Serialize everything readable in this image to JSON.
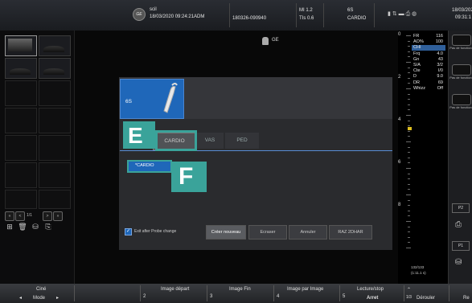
{
  "header": {
    "logo": "GE",
    "patient_name": "scil",
    "datetime": "18/03/2020 09:24:21ADM",
    "exam_id": "180326-090940",
    "mi": "MI 1.2",
    "tis": "TIs 0.6",
    "probe": "6S",
    "app": "CARDIO",
    "clock_date": "18/03/2020",
    "clock_time": "09:31:1"
  },
  "left_panel": {
    "page_indicator": "1/1",
    "nav": [
      "«",
      "<",
      ">",
      "»"
    ]
  },
  "center": {
    "probe_marker": "GE",
    "probe_name": "6S",
    "tabs": [
      "CARDIO",
      "VAS",
      "PED"
    ],
    "preset": "*CARDIO",
    "callout_e": "E",
    "callout_f": "F",
    "exit_checkbox_label": "Exit after Probe change",
    "buttons": [
      "Créer nouveau",
      "Ecraser",
      "Annuler",
      "RAZ 2DHAR"
    ],
    "scale": [
      "0",
      "2",
      "4",
      "6",
      "8"
    ],
    "frame_counter": "132/133",
    "frame_sub": "(1:11.1 s)"
  },
  "params": [
    {
      "k": "FR",
      "v": "116"
    },
    {
      "k": "AO%",
      "v": "100"
    },
    {
      "k": "CHI",
      "v": ""
    },
    {
      "k": "Frq",
      "v": "4.0"
    },
    {
      "k": "Gn",
      "v": "43"
    },
    {
      "k": "S/A",
      "v": "3/2"
    },
    {
      "k": "Cte",
      "v": "I/0"
    },
    {
      "k": "D",
      "v": "9.0"
    },
    {
      "k": "DR",
      "v": "69"
    },
    {
      "k": "Whizz",
      "v": "Off"
    }
  ],
  "right_panel": {
    "buttons": [
      "Pas de fonction",
      "Pas de fonction",
      "Pas de fonction"
    ],
    "p2": "P2",
    "p1": "P1"
  },
  "bottom": {
    "cine": "Ciné",
    "mode": "Mode",
    "image_depart": "Image départ",
    "n2": "2",
    "image_fin": "Image Fin",
    "n3": "3",
    "image_par_image": "Image par Image",
    "n4": "4",
    "lecture_stop": "Lecture/stop",
    "n5": "5",
    "arret": "Arret",
    "page": "1/3",
    "derouler": "Dérouler",
    "re": "Re"
  },
  "colors": {
    "accent_blue": "#1f67b9",
    "callout_teal": "#3aa39a",
    "panel_dark": "#2a2b2e"
  }
}
